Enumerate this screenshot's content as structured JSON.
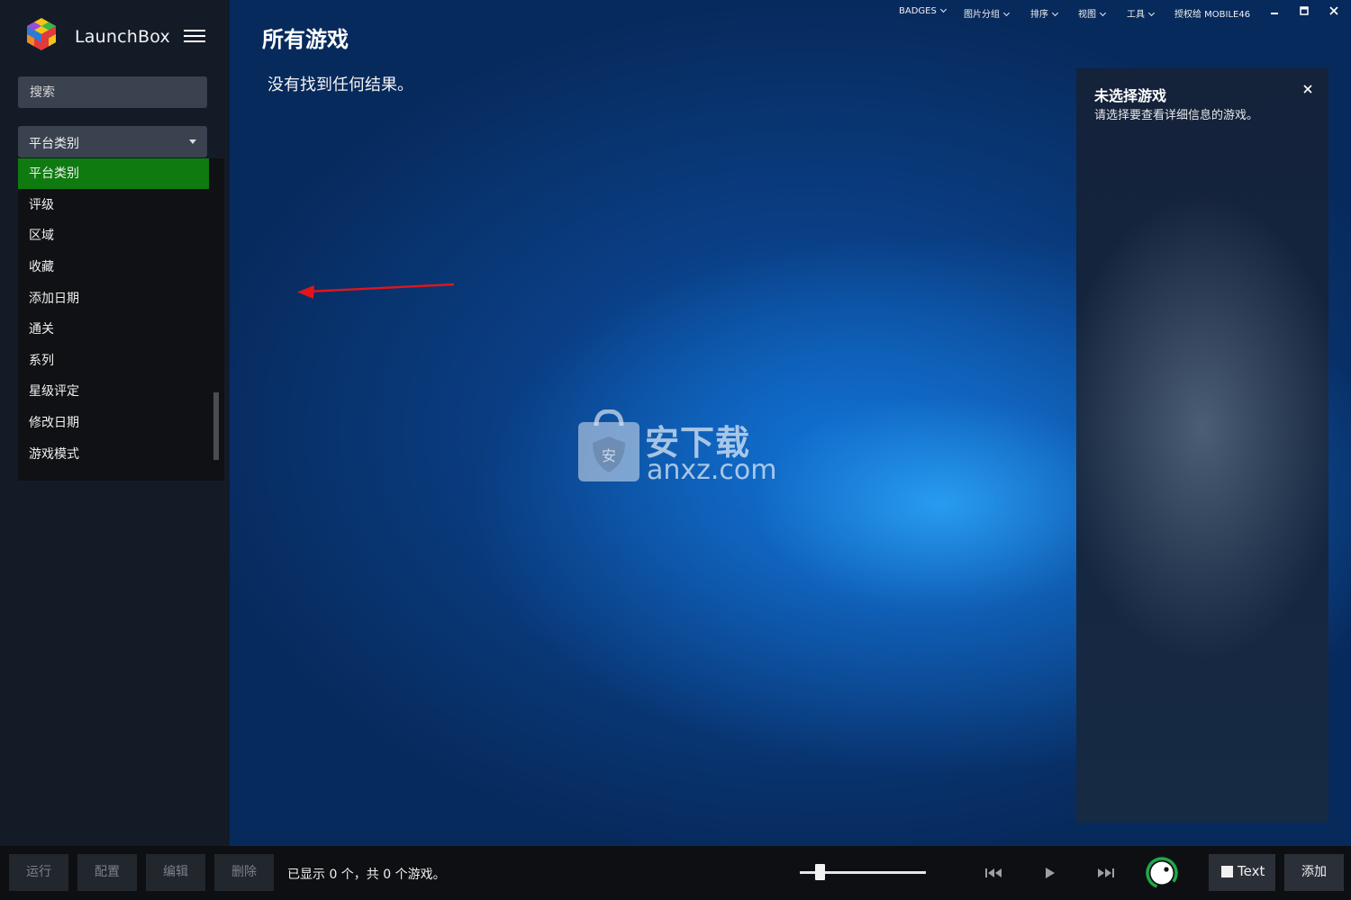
{
  "app": {
    "name": "LaunchBox"
  },
  "sidebar": {
    "search_placeholder": "搜索",
    "category_select": "平台类别",
    "dropdown_items": [
      {
        "label": "平台类别",
        "selected": true
      },
      {
        "label": "评级"
      },
      {
        "label": "区域"
      },
      {
        "label": "收藏"
      },
      {
        "label": "添加日期"
      },
      {
        "label": "通关"
      },
      {
        "label": "系列"
      },
      {
        "label": "星级评定"
      },
      {
        "label": "修改日期"
      },
      {
        "label": "游戏模式"
      }
    ]
  },
  "main": {
    "title": "所有游戏",
    "empty_message": "没有找到任何结果。"
  },
  "topbar": {
    "menus": [
      "BADGES",
      "图片分组",
      "排序",
      "视图",
      "工具"
    ],
    "license": "授权给 MOBILE46"
  },
  "detail_panel": {
    "title": "未选择游戏",
    "subtitle": "请选择要查看详细信息的游戏。"
  },
  "watermark": {
    "text": "安下载",
    "sub": "anxz.com"
  },
  "bottombar": {
    "buttons": [
      "运行",
      "配置",
      "编辑",
      "删除"
    ],
    "status": "已显示 0 个，共 0 个游戏。",
    "text_toggle": "Text",
    "add": "添加",
    "zoom_level": 0.12
  },
  "colors": {
    "selected_item": "#0f7a10",
    "annotation_arrow": "#e0161b",
    "status_ring": "#1fa84a"
  }
}
